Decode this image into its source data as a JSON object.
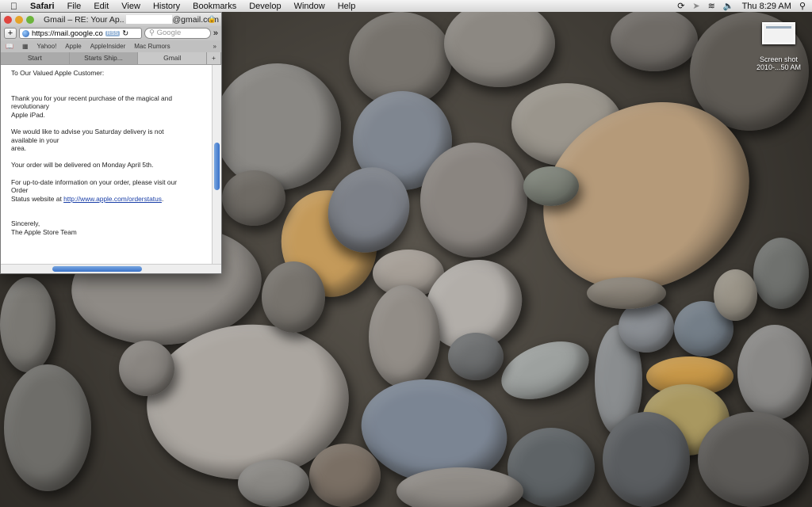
{
  "menubar": {
    "app": "Safari",
    "items": [
      "File",
      "Edit",
      "View",
      "History",
      "Bookmarks",
      "Develop",
      "Window",
      "Help"
    ],
    "clock": "Thu 8:29 AM"
  },
  "desktop_icon": {
    "label_line1": "Screen shot",
    "label_line2": "2010-...50 AM"
  },
  "browser": {
    "title_prefix": "Gmail – RE: Your Ap..",
    "title_suffix": "@gmail.com",
    "url": "https://mail.google.co",
    "rss": "RSS",
    "search_placeholder": "Google",
    "bookmarks": [
      "Yahoo!",
      "Apple",
      "AppleInsider",
      "Mac Rumors"
    ],
    "tabs": [
      "Start",
      "Starts Ship...",
      "Gmail"
    ],
    "active_tab": "Gmail",
    "add_tab": "+"
  },
  "email": {
    "greeting": "To Our Valued Apple Customer:",
    "p1": " Thank you for your recent purchase of the magical and\nrevolutionary\n Apple iPad.",
    "p2": " We would like to advise you Saturday delivery is not\navailable in your\n area.",
    "p3": " Your order will be delivered on Monday April 5th.",
    "p4_text": " For up-to-date information on your order, please visit our\nOrder\n Status website at ",
    "p4_link": "http://www.apple.com/orderstatus",
    "p4_end": ".",
    "closing": "Sincerely,",
    "signature": "The Apple Store Team"
  },
  "colors": {
    "link": "#1a3fa8",
    "scroll_accent": "#3a72c8"
  }
}
